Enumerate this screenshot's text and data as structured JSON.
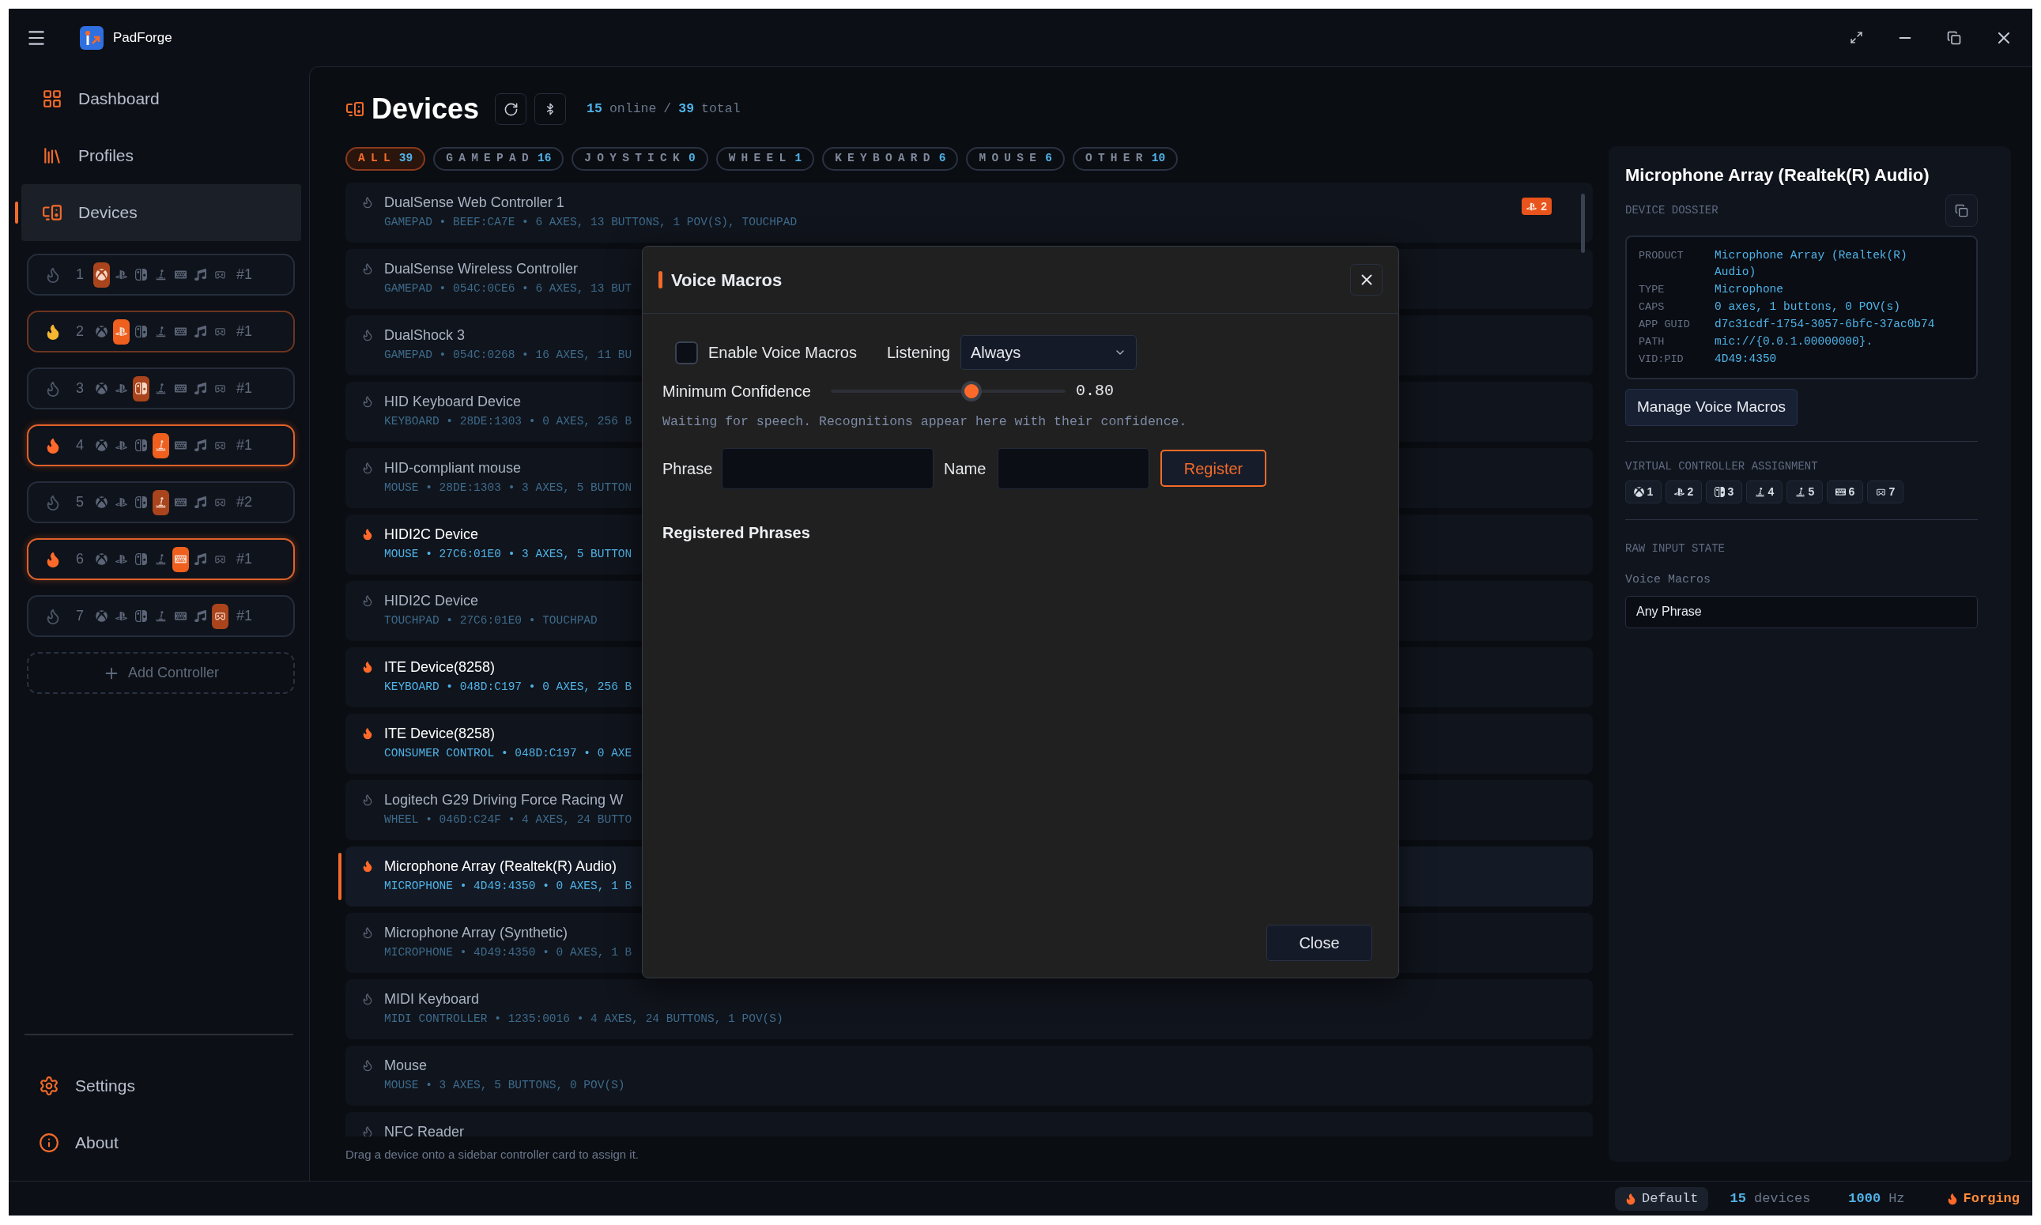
{
  "app": {
    "title": "PadForge"
  },
  "sidebar": {
    "nav": [
      {
        "label": "Dashboard",
        "kind": "dashboard",
        "selected": false
      },
      {
        "label": "Profiles",
        "kind": "profiles",
        "selected": false
      },
      {
        "label": "Devices",
        "kind": "devices",
        "selected": true
      }
    ],
    "controllers": [
      {
        "number": "1",
        "online": false,
        "active": false,
        "kind": "xbox",
        "instance": "#1"
      },
      {
        "number": "2",
        "online": true,
        "active": false,
        "kind": "playstation",
        "instance": "#1"
      },
      {
        "number": "3",
        "online": false,
        "active": false,
        "kind": "switch",
        "instance": "#1"
      },
      {
        "number": "4",
        "online": true,
        "active": true,
        "kind": "joystick",
        "instance": "#1"
      },
      {
        "number": "5",
        "online": false,
        "active": false,
        "kind": "joystick",
        "instance": "#2"
      },
      {
        "number": "6",
        "online": true,
        "active": true,
        "kind": "keyboard",
        "instance": "#1"
      },
      {
        "number": "7",
        "online": false,
        "active": false,
        "kind": "vr",
        "instance": "#1"
      }
    ],
    "add_controller": "Add Controller",
    "footer": [
      {
        "label": "Settings",
        "kind": "settings"
      },
      {
        "label": "About",
        "kind": "about"
      }
    ]
  },
  "header": {
    "title": "Devices",
    "online": "15",
    "online_label": "online",
    "separator": "/",
    "total": "39",
    "total_label": "total"
  },
  "filters": [
    {
      "label": "ALL",
      "count": "39",
      "selected": true
    },
    {
      "label": "GAMEPAD",
      "count": "16",
      "selected": false
    },
    {
      "label": "JOYSTICK",
      "count": "0",
      "selected": false
    },
    {
      "label": "WHEEL",
      "count": "1",
      "selected": false
    },
    {
      "label": "KEYBOARD",
      "count": "6",
      "selected": false
    },
    {
      "label": "MOUSE",
      "count": "6",
      "selected": false
    },
    {
      "label": "OTHER",
      "count": "10",
      "selected": false
    }
  ],
  "devices": [
    {
      "name": "DualSense Web Controller 1",
      "details": "GAMEPAD • BEEF:CA7E • 6 AXES, 13 BUTTONS, 1 POV(S), TOUCHPAD",
      "active": false,
      "selected": false,
      "badge": {
        "kind": "playstation",
        "label": "2"
      }
    },
    {
      "name": "DualSense Wireless Controller",
      "details": "GAMEPAD • 054C:0CE6 • 6 AXES, 13 BUT",
      "active": false,
      "selected": false
    },
    {
      "name": "DualShock 3",
      "details": "GAMEPAD • 054C:0268 • 16 AXES, 11 BU",
      "active": false,
      "selected": false
    },
    {
      "name": "HID Keyboard Device",
      "details": "KEYBOARD • 28DE:1303 • 0 AXES, 256 B",
      "active": false,
      "selected": false
    },
    {
      "name": "HID-compliant mouse",
      "details": "MOUSE • 28DE:1303 • 3 AXES, 5 BUTTON",
      "active": false,
      "selected": false
    },
    {
      "name": "HIDI2C Device",
      "details": "MOUSE • 27C6:01E0 • 3 AXES, 5 BUTTON",
      "active": true,
      "selected": false
    },
    {
      "name": "HIDI2C Device",
      "details": "TOUCHPAD • 27C6:01E0 • TOUCHPAD",
      "active": false,
      "selected": false
    },
    {
      "name": "ITE Device(8258)",
      "details": "KEYBOARD • 048D:C197 • 0 AXES, 256 B",
      "active": true,
      "selected": false
    },
    {
      "name": "ITE Device(8258)",
      "details": "CONSUMER CONTROL • 048D:C197 • 0 AXE",
      "active": true,
      "selected": false
    },
    {
      "name": "Logitech G29 Driving Force Racing W",
      "details": "WHEEL • 046D:C24F • 4 AXES, 24 BUTTO",
      "active": false,
      "selected": false
    },
    {
      "name": "Microphone Array (Realtek(R) Audio)",
      "details": "MICROPHONE • 4D49:4350 • 0 AXES, 1 B",
      "active": true,
      "selected": true
    },
    {
      "name": "Microphone Array (Synthetic)",
      "details": "MICROPHONE • 4D49:4350 • 0 AXES, 1 B",
      "active": false,
      "selected": false
    },
    {
      "name": "MIDI Keyboard",
      "details": "MIDI CONTROLLER • 1235:0016 • 4 AXES, 24 BUTTONS, 1 POV(S)",
      "active": false,
      "selected": false
    },
    {
      "name": "Mouse",
      "details": "MOUSE • 3 AXES, 5 BUTTONS, 0 POV(S)",
      "active": false,
      "selected": false
    },
    {
      "name": "NFC Reader",
      "active": false,
      "selected": false
    }
  ],
  "hint": "Drag a device onto a sidebar controller card to assign it.",
  "modal": {
    "title": "Voice Macros",
    "enable": {
      "label": "Enable Voice Macros",
      "checked": false
    },
    "listening": {
      "label": "Listening",
      "value": "Always"
    },
    "confidence": {
      "label": "Minimum Confidence",
      "level": 0.6,
      "reading": "0.80"
    },
    "status": "Waiting for speech. Recognitions appear here with their confidence.",
    "phrase_label": "Phrase",
    "name_label": "Name",
    "register": "Register",
    "registered_heading": "Registered Phrases",
    "close": "Close"
  },
  "details_panel": {
    "title": "Microphone Array (Realtek(R) Audio)",
    "dossier_label": "DEVICE DOSSIER",
    "dossier": [
      {
        "key": "PRODUCT",
        "value": "Microphone Array (Realtek(R) Audio)"
      },
      {
        "key": "TYPE",
        "value": "Microphone"
      },
      {
        "key": "CAPS",
        "value": "0 axes, 1 buttons, 0 POV(s)"
      },
      {
        "key": "APP GUID",
        "value": "d7c31cdf-1754-3057-6bfc-37ac0b74"
      },
      {
        "key": "PATH",
        "value": "mic://{0.0.1.00000000}."
      },
      {
        "key": "VID:PID",
        "value": "4D49:4350"
      }
    ],
    "manage_button": "Manage Voice Macros",
    "assignment_label": "VIRTUAL CONTROLLER ASSIGNMENT",
    "assignments": [
      {
        "kind": "xbox",
        "label": "1"
      },
      {
        "kind": "playstation",
        "label": "2"
      },
      {
        "kind": "switch",
        "label": "3"
      },
      {
        "kind": "joystick",
        "label": "4"
      },
      {
        "kind": "joystick",
        "label": "5"
      },
      {
        "kind": "keyboard",
        "label": "6"
      },
      {
        "kind": "vr",
        "label": "7"
      }
    ],
    "raw_label": "RAW INPUT STATE",
    "raw_field_label": "Voice Macros",
    "raw_field_value": "Any Phrase"
  },
  "status_bar": {
    "profile": "Default",
    "devices_count": "15",
    "devices_label": "devices",
    "rate": "1000",
    "rate_label": "Hz",
    "state": "Forging"
  }
}
